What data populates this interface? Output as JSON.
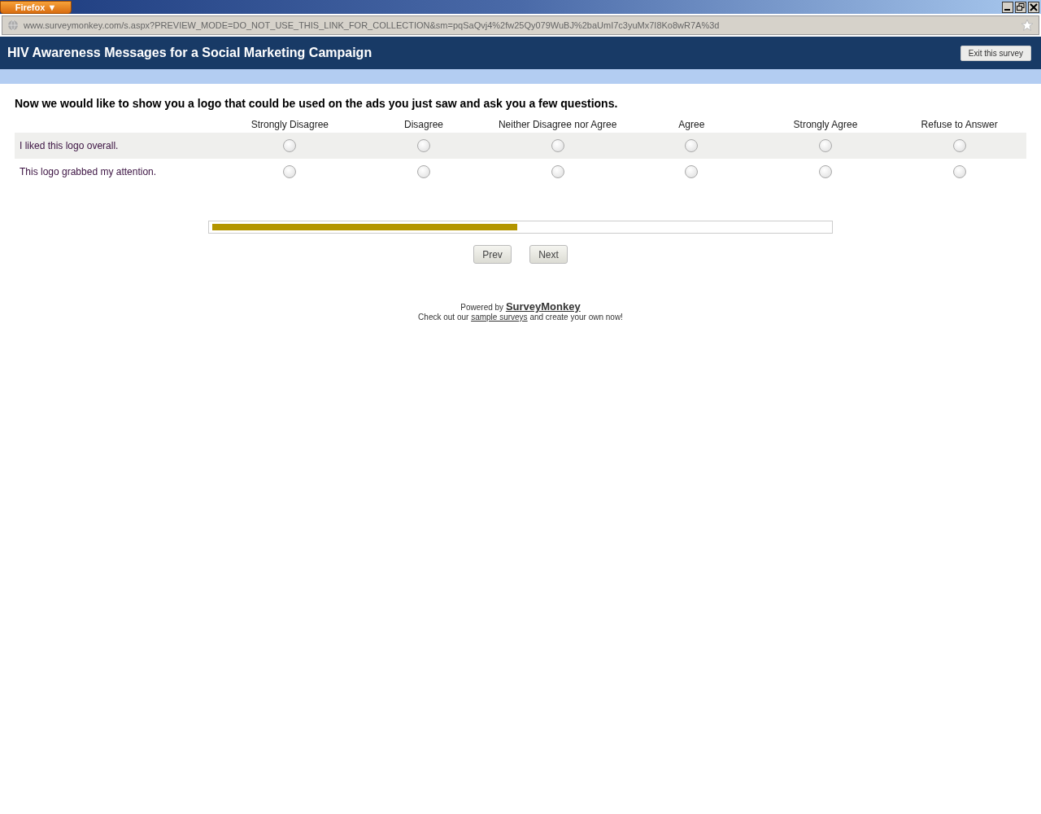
{
  "browser": {
    "menu_button": "Firefox ▼",
    "url": "www.surveymonkey.com/s.aspx?PREVIEW_MODE=DO_NOT_USE_THIS_LINK_FOR_COLLECTION&sm=pqSaQvj4%2fw25Qy079WuBJ%2baUmI7c3yuMx7I8Ko8wR7A%3d"
  },
  "header": {
    "title": "HIV Awareness Messages for a Social Marketing Campaign",
    "exit_button": "Exit this survey"
  },
  "question": {
    "text": "Now we would like to show you a logo that could be used on the ads you just saw and ask you a few questions.",
    "columns": [
      "Strongly Disagree",
      "Disagree",
      "Neither Disagree nor Agree",
      "Agree",
      "Strongly Agree",
      "Refuse to Answer"
    ],
    "rows": [
      {
        "label": "I liked this logo overall.",
        "choices": [
          {
            "selected": false
          },
          {
            "selected": false
          },
          {
            "selected": false
          },
          {
            "selected": false
          },
          {
            "selected": false
          },
          {
            "selected": false
          }
        ]
      },
      {
        "label": "This logo grabbed my attention.",
        "choices": [
          {
            "selected": false
          },
          {
            "selected": false
          },
          {
            "selected": false
          },
          {
            "selected": false
          },
          {
            "selected": false
          },
          {
            "selected": false
          }
        ]
      }
    ]
  },
  "progress": {
    "level": 0.495
  },
  "nav_buttons": [
    "Prev",
    "Next"
  ],
  "footer": {
    "powered_by": "Powered by",
    "brand_link": "SurveyMonkey",
    "line_start": "Check out our",
    "samples_link": "sample surveys",
    "line_end": "and create your own now!"
  }
}
